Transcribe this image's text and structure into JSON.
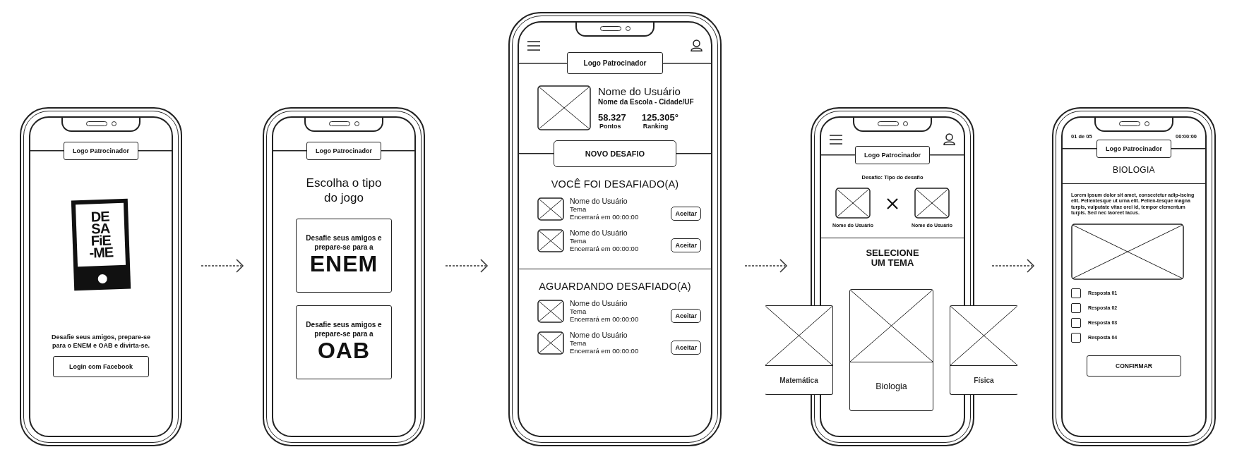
{
  "screens": [
    {
      "kind": "login",
      "sponsor": "Logo Patrocinador",
      "logo_lines": [
        "DE",
        "SA",
        "FiE",
        "-ME"
      ],
      "tagline": "Desafie seus amigos, prepare-se para o ENEM e OAB e divirta-se.",
      "login_button": "Login com Facebook"
    },
    {
      "kind": "game_type",
      "sponsor": "Logo Patrocinador",
      "title": "Escolha o tipo do jogo",
      "options": [
        {
          "intro": "Desafie seus amigos e prepare-se para a",
          "exam": "ENEM"
        },
        {
          "intro": "Desafie seus amigos e prepare-se para a",
          "exam": "OAB"
        }
      ]
    },
    {
      "kind": "home",
      "sponsor": "Logo Patrocinador",
      "user": {
        "name": "Nome do Usuário",
        "school": "Nome da Escola - Cidade/UF",
        "points": "58.327",
        "points_label": "Pontos",
        "rank": "125.305°",
        "rank_label": "Ranking"
      },
      "new_challenge": "NOVO DESAFIO",
      "sections": [
        {
          "title": "VOCÊ FOI DESAFIADO(A)",
          "rows": [
            {
              "name": "Nome do Usuário",
              "theme": "Tema",
              "ends": "Encerrará em 00:00:00",
              "action": "Aceitar"
            },
            {
              "name": "Nome do Usuário",
              "theme": "Tema",
              "ends": "Encerrará em 00:00:00",
              "action": "Aceitar"
            }
          ]
        },
        {
          "title": "AGUARDANDO DESAFIADO(A)",
          "rows": [
            {
              "name": "Nome do Usuário",
              "theme": "Tema",
              "ends": "Encerrará em 00:00:00",
              "action": "Aceitar"
            },
            {
              "name": "Nome do Usuário",
              "theme": "Tema",
              "ends": "Encerrará em 00:00:00",
              "action": "Aceitar"
            }
          ]
        }
      ]
    },
    {
      "kind": "select_theme",
      "sponsor": "Logo Patrocinador",
      "challenge_type": "Desafio: Tipo do desafio",
      "players": [
        "Nome do Usuário",
        "Nome do Usuário"
      ],
      "title": "SELECIONE UM TEMA",
      "themes": [
        {
          "label": "Matemática",
          "selected": false
        },
        {
          "label": "Biologia",
          "selected": true
        },
        {
          "label": "Física",
          "selected": false
        }
      ]
    },
    {
      "kind": "question",
      "progress": "01 de 05",
      "timer": "00:00:00",
      "sponsor": "Logo Patrocinador",
      "subject": "BIOLOGIA",
      "text": "Lorem ipsum dolor sit amet, consectetur adip-iscing elit. Pellentesque ut urna elit. Pellen-tesque magna turpis, vulputate vitae orci id, tempor elementum turpis. Sed nec laoreet lacus.",
      "answers": [
        {
          "label": "Resposta 01",
          "checked": false
        },
        {
          "label": "Resposta 02",
          "checked": false
        },
        {
          "label": "Resposta 03",
          "checked": false
        },
        {
          "label": "Resposta 04",
          "checked": false
        }
      ],
      "confirm": "CONFIRMAR"
    }
  ]
}
